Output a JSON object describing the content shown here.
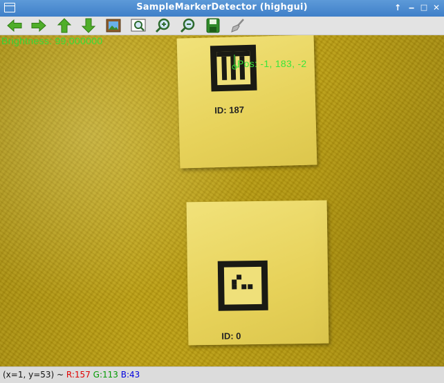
{
  "window": {
    "title": "SampleMarkerDetector (highgui)",
    "controls": [
      "keep-above",
      "minimize",
      "maximize",
      "close"
    ]
  },
  "toolbar": {
    "buttons": [
      {
        "name": "pan-left",
        "icon": "arrow-left-icon"
      },
      {
        "name": "pan-right",
        "icon": "arrow-right-icon"
      },
      {
        "name": "pan-up",
        "icon": "arrow-up-icon"
      },
      {
        "name": "pan-down",
        "icon": "arrow-down-icon"
      },
      {
        "name": "zoom-fit",
        "icon": "picture-icon"
      },
      {
        "name": "zoom-original",
        "icon": "zoom-original-icon"
      },
      {
        "name": "zoom-in",
        "icon": "zoom-in-icon"
      },
      {
        "name": "zoom-out",
        "icon": "zoom-out-icon"
      },
      {
        "name": "save",
        "icon": "save-icon"
      },
      {
        "name": "properties",
        "icon": "brush-icon"
      }
    ]
  },
  "overlay": {
    "brightness": "Brightness: 99,000000",
    "position": "Pos: -1, 183, -2"
  },
  "markers": [
    {
      "label": "ID: 187"
    },
    {
      "label": "ID: 0"
    }
  ],
  "status": {
    "coords": "(x=1, y=53) ~ ",
    "r": "R:157",
    "g": "G:113",
    "b": "B:43",
    "colors": {
      "r": "#e00000",
      "g": "#009a00",
      "b": "#0000e0"
    }
  },
  "colors": {
    "titlebar": "#4a8ad0",
    "overlay_text": "#39e639"
  }
}
